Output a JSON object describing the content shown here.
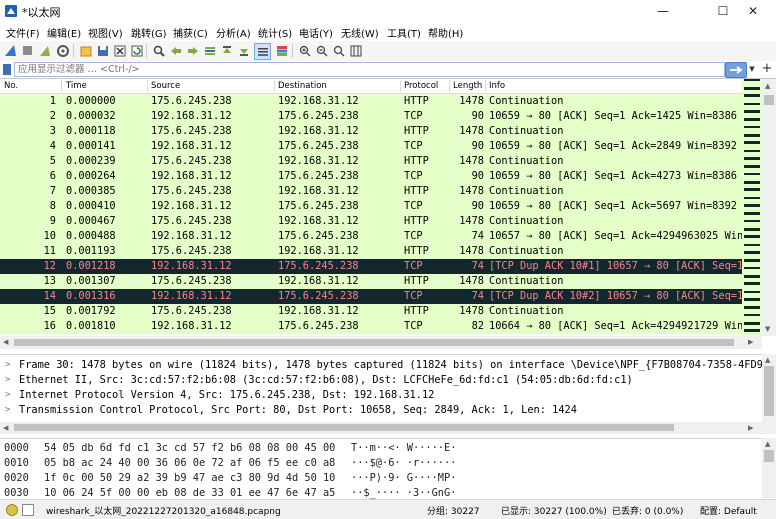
{
  "window": {
    "title": "*以太网",
    "minimize": "—",
    "maximize": "☐",
    "close": "✕"
  },
  "menu": [
    "文件(F)",
    "编辑(E)",
    "视图(V)",
    "跳转(G)",
    "捕获(C)",
    "分析(A)",
    "统计(S)",
    "电话(Y)",
    "无线(W)",
    "工具(T)",
    "帮助(H)"
  ],
  "toolbar": {
    "icons": [
      "shark-fin-icon",
      "stop-icon",
      "restart-icon",
      "options-gear-icon",
      "open-file-icon",
      "save-file-icon",
      "close-file-icon",
      "reload-icon",
      "find-icon",
      "go-back-icon",
      "go-forward-icon",
      "go-to-packet-icon",
      "first-packet-icon",
      "last-packet-icon",
      "autoscroll-icon",
      "colorize-icon",
      "zoom-in-icon",
      "zoom-out-icon",
      "normal-size-icon",
      "resize-columns-icon"
    ]
  },
  "filter": {
    "placeholder": "应用显示过滤器 … <Ctrl-/>",
    "value": "",
    "apply_icon": "arrow-right-icon"
  },
  "packet_list": {
    "columns": [
      "No.",
      "Time",
      "Source",
      "Destination",
      "Protocol",
      "Length",
      "Info"
    ],
    "rows": [
      {
        "no": "1",
        "time": "0.000000",
        "src": "175.6.245.238",
        "dst": "192.168.31.12",
        "proto": "HTTP",
        "len": "1478",
        "info": "Continuation",
        "dark": false
      },
      {
        "no": "2",
        "time": "0.000032",
        "src": "192.168.31.12",
        "dst": "175.6.245.238",
        "proto": "TCP",
        "len": "90",
        "info": "10659 → 80 [ACK] Seq=1 Ack=1425 Win=8386 L",
        "dark": false
      },
      {
        "no": "3",
        "time": "0.000118",
        "src": "175.6.245.238",
        "dst": "192.168.31.12",
        "proto": "HTTP",
        "len": "1478",
        "info": "Continuation",
        "dark": false
      },
      {
        "no": "4",
        "time": "0.000141",
        "src": "192.168.31.12",
        "dst": "175.6.245.238",
        "proto": "TCP",
        "len": "90",
        "info": "10659 → 80 [ACK] Seq=1 Ack=2849 Win=8392 L",
        "dark": false
      },
      {
        "no": "5",
        "time": "0.000239",
        "src": "175.6.245.238",
        "dst": "192.168.31.12",
        "proto": "HTTP",
        "len": "1478",
        "info": "Continuation",
        "dark": false
      },
      {
        "no": "6",
        "time": "0.000264",
        "src": "192.168.31.12",
        "dst": "175.6.245.238",
        "proto": "TCP",
        "len": "90",
        "info": "10659 → 80 [ACK] Seq=1 Ack=4273 Win=8386 L",
        "dark": false
      },
      {
        "no": "7",
        "time": "0.000385",
        "src": "175.6.245.238",
        "dst": "192.168.31.12",
        "proto": "HTTP",
        "len": "1478",
        "info": "Continuation",
        "dark": false
      },
      {
        "no": "8",
        "time": "0.000410",
        "src": "192.168.31.12",
        "dst": "175.6.245.238",
        "proto": "TCP",
        "len": "90",
        "info": "10659 → 80 [ACK] Seq=1 Ack=5697 Win=8392 L",
        "dark": false
      },
      {
        "no": "9",
        "time": "0.000467",
        "src": "175.6.245.238",
        "dst": "192.168.31.12",
        "proto": "HTTP",
        "len": "1478",
        "info": "Continuation",
        "dark": false
      },
      {
        "no": "10",
        "time": "0.000488",
        "src": "192.168.31.12",
        "dst": "175.6.245.238",
        "proto": "TCP",
        "len": "74",
        "info": "10657 → 80 [ACK] Seq=1 Ack=4294963025 Win=",
        "dark": false
      },
      {
        "no": "11",
        "time": "0.001193",
        "src": "175.6.245.238",
        "dst": "192.168.31.12",
        "proto": "HTTP",
        "len": "1478",
        "info": "Continuation",
        "dark": false
      },
      {
        "no": "12",
        "time": "0.001218",
        "src": "192.168.31.12",
        "dst": "175.6.245.238",
        "proto": "TCP",
        "len": "74",
        "info": "[TCP Dup ACK 10#1] 10657 → 80 [ACK] Seq=1",
        "dark": true
      },
      {
        "no": "13",
        "time": "0.001307",
        "src": "175.6.245.238",
        "dst": "192.168.31.12",
        "proto": "HTTP",
        "len": "1478",
        "info": "Continuation",
        "dark": false
      },
      {
        "no": "14",
        "time": "0.001316",
        "src": "192.168.31.12",
        "dst": "175.6.245.238",
        "proto": "TCP",
        "len": "74",
        "info": "[TCP Dup ACK 10#2] 10657 → 80 [ACK] Seq=1",
        "dark": true
      },
      {
        "no": "15",
        "time": "0.001792",
        "src": "175.6.245.238",
        "dst": "192.168.31.12",
        "proto": "HTTP",
        "len": "1478",
        "info": "Continuation",
        "dark": false
      },
      {
        "no": "16",
        "time": "0.001810",
        "src": "192.168.31.12",
        "dst": "175.6.245.238",
        "proto": "TCP",
        "len": "82",
        "info": "10664 → 80 [ACK] Seq=1 Ack=4294921729 Win=",
        "dark": false
      }
    ]
  },
  "details": [
    "Frame 30: 1478 bytes on wire (11824 bits), 1478 bytes captured (11824 bits) on interface \\Device\\NPF_{F7B08704-7358-4FD9-BF",
    "Ethernet II, Src: 3c:cd:57:f2:b6:08 (3c:cd:57:f2:b6:08), Dst: LCFCHeFe_6d:fd:c1 (54:05:db:6d:fd:c1)",
    "Internet Protocol Version 4, Src: 175.6.245.238, Dst: 192.168.31.12",
    "Transmission Control Protocol, Src Port: 80, Dst Port: 10658, Seq: 2849, Ack: 1, Len: 1424"
  ],
  "bytes": [
    {
      "offset": "0000",
      "hex": "54 05 db 6d fd c1 3c cd  57 f2 b6 08 08 00 45 00",
      "ascii": "T··m··<· W·····E·"
    },
    {
      "offset": "0010",
      "hex": "05 b8 ac 24 40 00 36 06  0e 72 af 06 f5 ee c0 a8",
      "ascii": "···$@·6· ·r······"
    },
    {
      "offset": "0020",
      "hex": "1f 0c 00 50 29 a2 39 b9  47 ae c3 80 9d 4d 50 10",
      "ascii": "···P)·9· G····MP·"
    },
    {
      "offset": "0030",
      "hex": "10 06 24 5f 00 00 eb 08  de 33 01 ee 47 6e 47 a5",
      "ascii": "··$_···· ·3··GnG·"
    }
  ],
  "status": {
    "file": "wireshark_以太网_20221227201320_a16848.pcapng",
    "packets": "分组: 30227",
    "displayed": "已显示: 30227 (100.0%)",
    "dropped": "已丢弃: 0 (0.0%)",
    "profile": "配置: Default"
  },
  "colors": {
    "row_normal_bg": "#e4ffc7",
    "row_dark_bg": "#12272e",
    "row_dark_fg": "#f78787",
    "accent": "#4b7fc2"
  }
}
